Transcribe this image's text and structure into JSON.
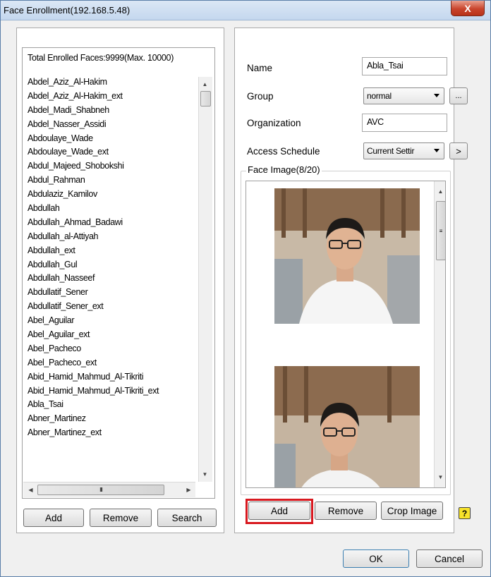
{
  "window": {
    "title": "Face Enrollment(192.168.5.48)",
    "close_symbol": "X"
  },
  "left": {
    "total_label": "Total Enrolled Faces:9999(Max. 10000)",
    "names": [
      "Abdel_Aziz_Al-Hakim",
      "Abdel_Aziz_Al-Hakim_ext",
      "Abdel_Madi_Shabneh",
      "Abdel_Nasser_Assidi",
      "Abdoulaye_Wade",
      "Abdoulaye_Wade_ext",
      "Abdul_Majeed_Shobokshi",
      "Abdul_Rahman",
      "Abdulaziz_Kamilov",
      "Abdullah",
      "Abdullah_Ahmad_Badawi",
      "Abdullah_al-Attiyah",
      "Abdullah_ext",
      "Abdullah_Gul",
      "Abdullah_Nasseef",
      "Abdullatif_Sener",
      "Abdullatif_Sener_ext",
      "Abel_Aguilar",
      "Abel_Aguilar_ext",
      "Abel_Pacheco",
      "Abel_Pacheco_ext",
      "Abid_Hamid_Mahmud_Al-Tikriti",
      "Abid_Hamid_Mahmud_Al-Tikriti_ext",
      "Abla_Tsai",
      "Abner_Martinez",
      "Abner_Martinez_ext"
    ],
    "hscroll_grip": "III",
    "buttons": {
      "add": "Add",
      "remove": "Remove",
      "search": "Search"
    }
  },
  "right": {
    "name_label": "Name",
    "name_value": "Abla_Tsai",
    "group_label": "Group",
    "group_value": "normal",
    "group_more": "...",
    "org_label": "Organization",
    "org_value": "AVC",
    "schedule_label": "Access Schedule",
    "schedule_value": "Current Settir",
    "schedule_next": ">",
    "face_image_label": "Face Image(8/20)",
    "buttons": {
      "add": "Add",
      "remove": "Remove",
      "crop": "Crop Image"
    },
    "help_symbol": "?"
  },
  "footer": {
    "ok": "OK",
    "cancel": "Cancel"
  },
  "colors": {
    "highlight": "#d8181f",
    "title_bar": "#c4d7ee",
    "close": "#c9452d"
  }
}
